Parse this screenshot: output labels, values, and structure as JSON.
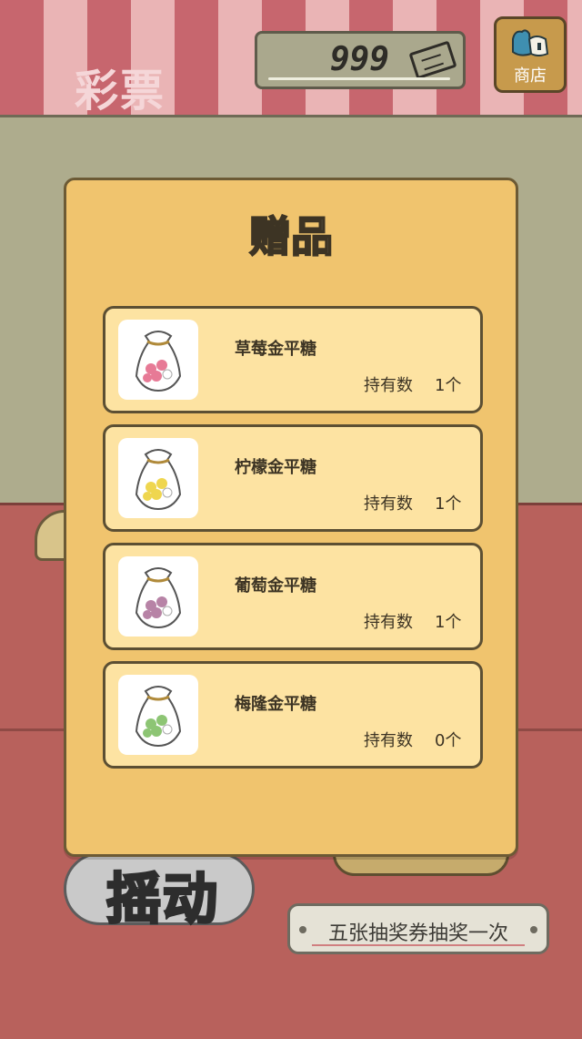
{
  "header": {
    "title": "彩票",
    "ticket_count": "999",
    "shop_label": "商店"
  },
  "modal": {
    "title": "赠品",
    "items": [
      {
        "name": "草莓金平糖",
        "qty_label": "持有数",
        "qty": "1个",
        "candy_color": "#e77a96"
      },
      {
        "name": "柠檬金平糖",
        "qty_label": "持有数",
        "qty": "1个",
        "candy_color": "#efd64f"
      },
      {
        "name": "葡萄金平糖",
        "qty_label": "持有数",
        "qty": "1个",
        "candy_color": "#b783a6"
      },
      {
        "name": "梅隆金平糖",
        "qty_label": "持有数",
        "qty": "0个",
        "candy_color": "#8dc574"
      }
    ]
  },
  "bottom": {
    "shake_label": "摇动",
    "draw_rule": "五张抽奖券抽奖一次"
  },
  "colors": {
    "modal_bg": "#f0c46e",
    "card_bg": "#fde3a2",
    "stripe_red": "#c7666e",
    "floor": "#b8615c"
  }
}
